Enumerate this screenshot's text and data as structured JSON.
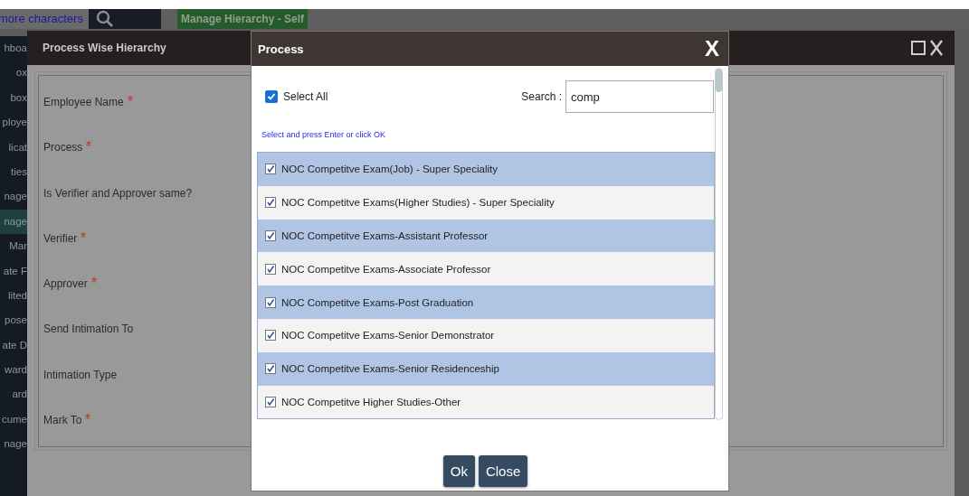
{
  "top_bar": {
    "link": "more characters",
    "tab": "Manage Hierarchy - Self"
  },
  "sidebar": {
    "items": [
      {
        "label": "hboa",
        "selected": false
      },
      {
        "label": "ox",
        "selected": false
      },
      {
        "label": "box",
        "selected": false
      },
      {
        "label": "ploye",
        "selected": false
      },
      {
        "label": "licat",
        "selected": false
      },
      {
        "label": "ties",
        "selected": false
      },
      {
        "label": "nage",
        "selected": false
      },
      {
        "label": "nage",
        "selected": true
      },
      {
        "label": "Mar",
        "selected": false
      },
      {
        "label": "ate F",
        "selected": false
      },
      {
        "label": "lited",
        "selected": false
      },
      {
        "label": "pose",
        "selected": false
      },
      {
        "label": "ate D",
        "selected": false
      },
      {
        "label": "ward",
        "selected": false
      },
      {
        "label": "ard",
        "selected": false
      },
      {
        "label": "cume",
        "selected": false
      },
      {
        "label": "nage",
        "selected": false
      }
    ]
  },
  "hierarchy_window": {
    "title": "Process Wise Hierarchy",
    "fields": [
      {
        "label": "Employee Name",
        "required": true
      },
      {
        "label": "Process",
        "required": true
      },
      {
        "label": "Is Verifier and Approver same?",
        "required": false
      },
      {
        "label": "Verifier",
        "required": true
      },
      {
        "label": "Approver",
        "required": true
      },
      {
        "label": "Send Intimation To",
        "required": false
      },
      {
        "label": "Intimation Type",
        "required": false
      },
      {
        "label": "Mark To",
        "required": true
      }
    ]
  },
  "process_dialog": {
    "title": "Process",
    "close": "X",
    "select_all": {
      "label": "Select All",
      "checked": true
    },
    "search": {
      "label": "Search :",
      "value": "comp"
    },
    "hint": "Select and press Enter or click OK",
    "items": [
      {
        "label": "NOC Competitve Exam(Job) - Super Speciality",
        "checked": true
      },
      {
        "label": "NOC Competitve Exams(Higher Studies) - Super Speciality",
        "checked": true
      },
      {
        "label": "NOC Competitve Exams-Assistant Professor",
        "checked": true
      },
      {
        "label": "NOC Competitve Exams-Associate Professor",
        "checked": true
      },
      {
        "label": "NOC Competitve Exams-Post Graduation",
        "checked": true
      },
      {
        "label": "NOC Competitve Exams-Senior Demonstrator",
        "checked": true
      },
      {
        "label": "NOC Competitve Exams-Senior Residenceship",
        "checked": true
      },
      {
        "label": "NOC Competitve Higher Studies-Other",
        "checked": true
      }
    ],
    "buttons": [
      "Ok",
      "Close"
    ]
  }
}
